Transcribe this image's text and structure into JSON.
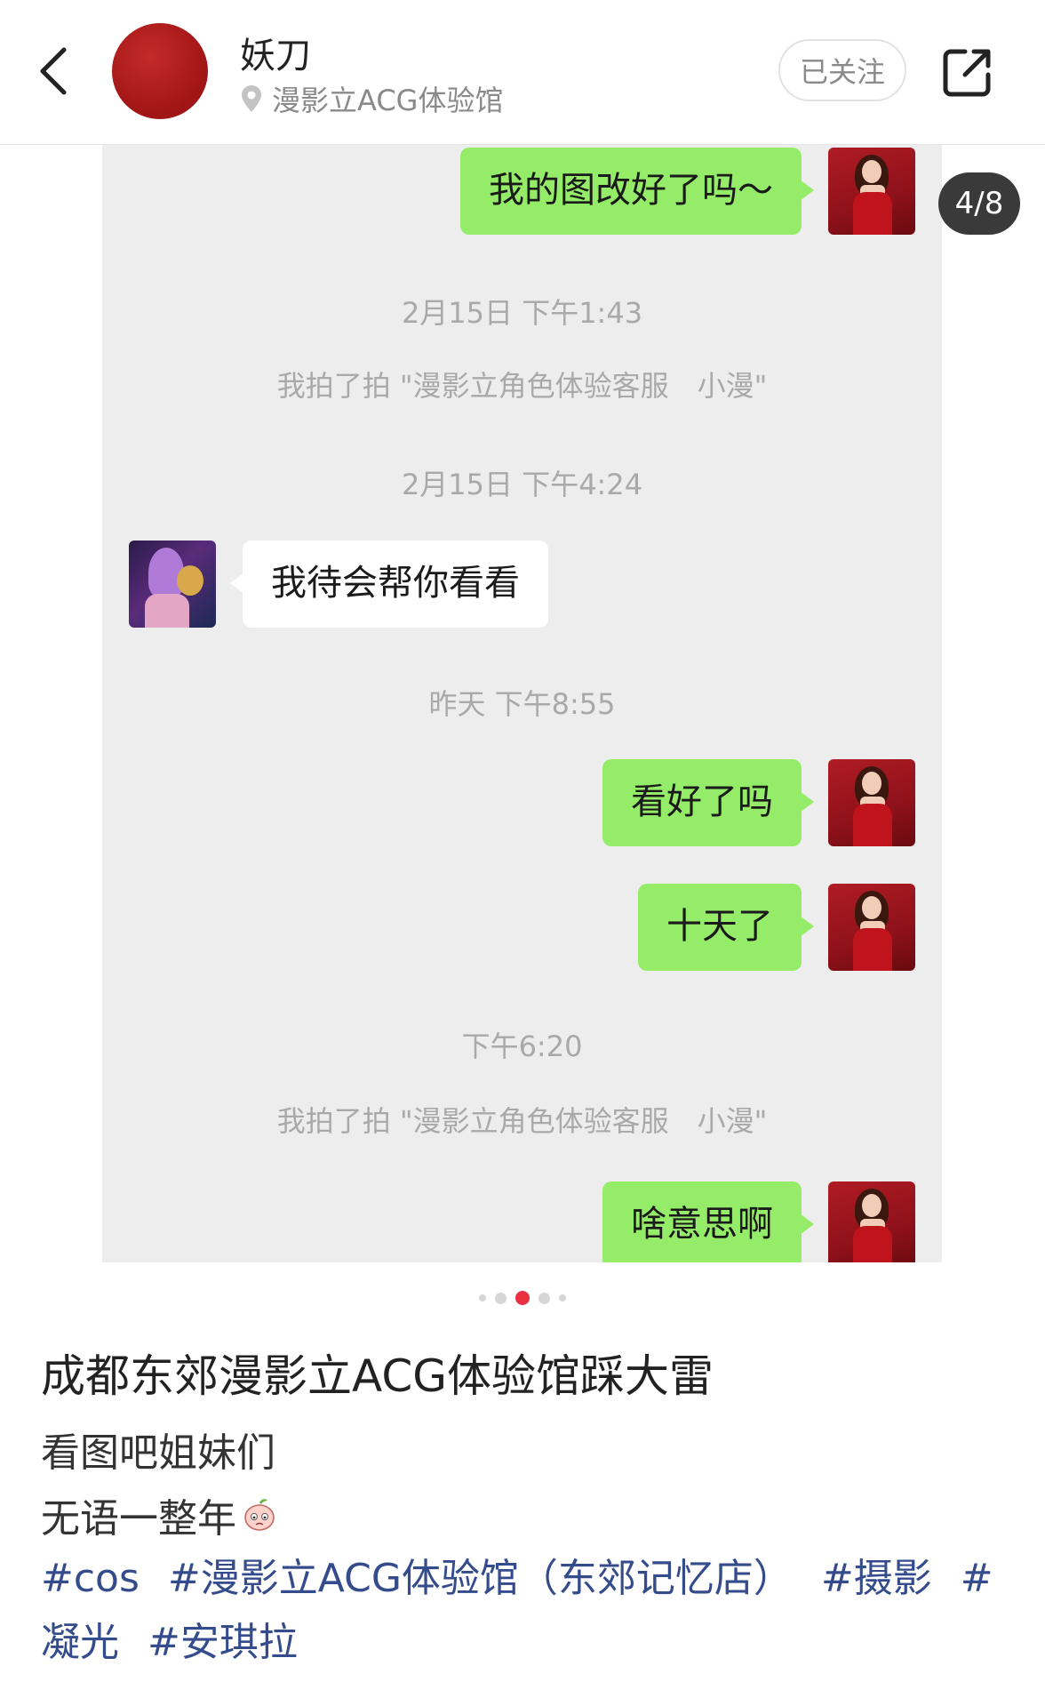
{
  "header": {
    "author_name": "妖刀",
    "location": "漫影立ACG体验馆",
    "follow_label": "已关注",
    "icons": [
      "back-arrow-icon",
      "location-pin-icon",
      "share-icon"
    ]
  },
  "viewer": {
    "page_counter": "4/8",
    "chat": {
      "msg1": "我的图改好了吗～",
      "ts1": "2月15日 下午1:43",
      "sys1": "我拍了拍 \"漫影立角色体验客服　小漫\"",
      "ts2": "2月15日 下午4:24",
      "msg2": "我待会帮你看看",
      "ts3": "昨天 下午8:55",
      "msg3": "看好了吗",
      "msg4": "十天了",
      "ts4": "下午6:20",
      "sys2": "我拍了拍 \"漫影立角色体验客服　小漫\"",
      "msg5": "啥意思啊"
    },
    "colors": {
      "sent_bubble": "#95ec69",
      "received_bubble": "#ffffff",
      "chat_bg": "#ededed",
      "active_dot": "#e8303f"
    }
  },
  "post": {
    "title": "成都东郊漫影立ACG体验馆踩大雷",
    "line1": "看图吧姐妹们",
    "line2": "无语一整年",
    "tags": [
      "#cos",
      "#漫影立ACG体验馆（东郊记忆店）",
      "#摄影",
      "#凝光",
      "#安琪拉"
    ]
  }
}
